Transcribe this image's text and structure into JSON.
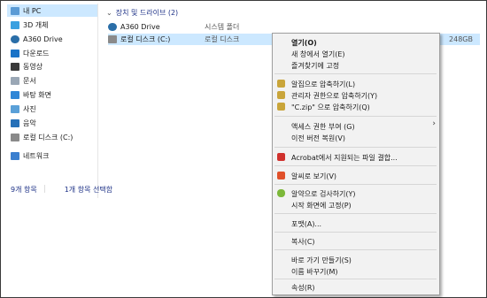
{
  "sidebar": {
    "items": [
      {
        "label": "내 PC",
        "icon": "pc-icon",
        "color": "#5b9bd5"
      },
      {
        "label": "3D 개체",
        "icon": "3d-objects-icon",
        "color": "#3aa0e0"
      },
      {
        "label": "A360 Drive",
        "icon": "a360-drive-icon",
        "color": "#2a6ea8"
      },
      {
        "label": "다운로드",
        "icon": "download-icon",
        "color": "#1a73c7"
      },
      {
        "label": "동영상",
        "icon": "video-icon",
        "color": "#3a3a3a"
      },
      {
        "label": "문서",
        "icon": "document-icon",
        "color": "#9aa7b5"
      },
      {
        "label": "바탕 화면",
        "icon": "desktop-icon",
        "color": "#2f86d6"
      },
      {
        "label": "사진",
        "icon": "pictures-icon",
        "color": "#5aa0d8"
      },
      {
        "label": "음악",
        "icon": "music-icon",
        "color": "#2670b8"
      },
      {
        "label": "로컬 디스크 (C:)",
        "icon": "local-disk-icon",
        "color": "#8a8a8a"
      },
      {
        "label": "네트워크",
        "icon": "network-icon",
        "color": "#3b7fcf"
      }
    ]
  },
  "content": {
    "group_header": "장치 및 드라이브 (2)",
    "items": [
      {
        "name": "A360 Drive",
        "type": "시스템 폴더",
        "size": "",
        "icon": "a360-drive-icon"
      },
      {
        "name": "로컬 디스크 (C:)",
        "type": "로컬 디스크",
        "size": "248GB",
        "icon": "local-disk-icon"
      }
    ]
  },
  "status": {
    "count": "9개 항목",
    "selected": "1개 항목 선택함"
  },
  "context_menu": {
    "items": [
      {
        "label": "열기(O)",
        "bold": true
      },
      {
        "label": "새 창에서 열기(E)"
      },
      {
        "label": "즐겨찾기에 고정"
      },
      {
        "label": "알집으로 압축하기(L)",
        "icon": "alzip-icon"
      },
      {
        "label": "관리자 권한으로 압축하기(Y)",
        "icon": "alzip-admin-icon"
      },
      {
        "label": "\"C.zip\" 으로 압축하기(Q)",
        "icon": "alzip-zip-icon"
      },
      {
        "label": "액세스 권한 부여 (G)",
        "submenu": true
      },
      {
        "label": "이전 버전 복원(V)"
      },
      {
        "label": "Acrobat에서 지원되는 파일 결합...",
        "icon": "acrobat-icon"
      },
      {
        "label": "알씨로 보기(V)",
        "icon": "alsee-icon"
      },
      {
        "label": "알약으로 검사하기(Y)",
        "icon": "alyac-icon"
      },
      {
        "label": "시작 화면에 고정(P)"
      },
      {
        "label": "포맷(A)..."
      },
      {
        "label": "복사(C)"
      },
      {
        "label": "바로 가기 만들기(S)"
      },
      {
        "label": "이름 바꾸기(M)"
      },
      {
        "label": "속성(R)"
      }
    ],
    "submenu_arrow": "›"
  },
  "colors": {
    "selection": "#cce8ff",
    "menu_bg": "#f2f2f2",
    "link_text": "#1e3287"
  }
}
